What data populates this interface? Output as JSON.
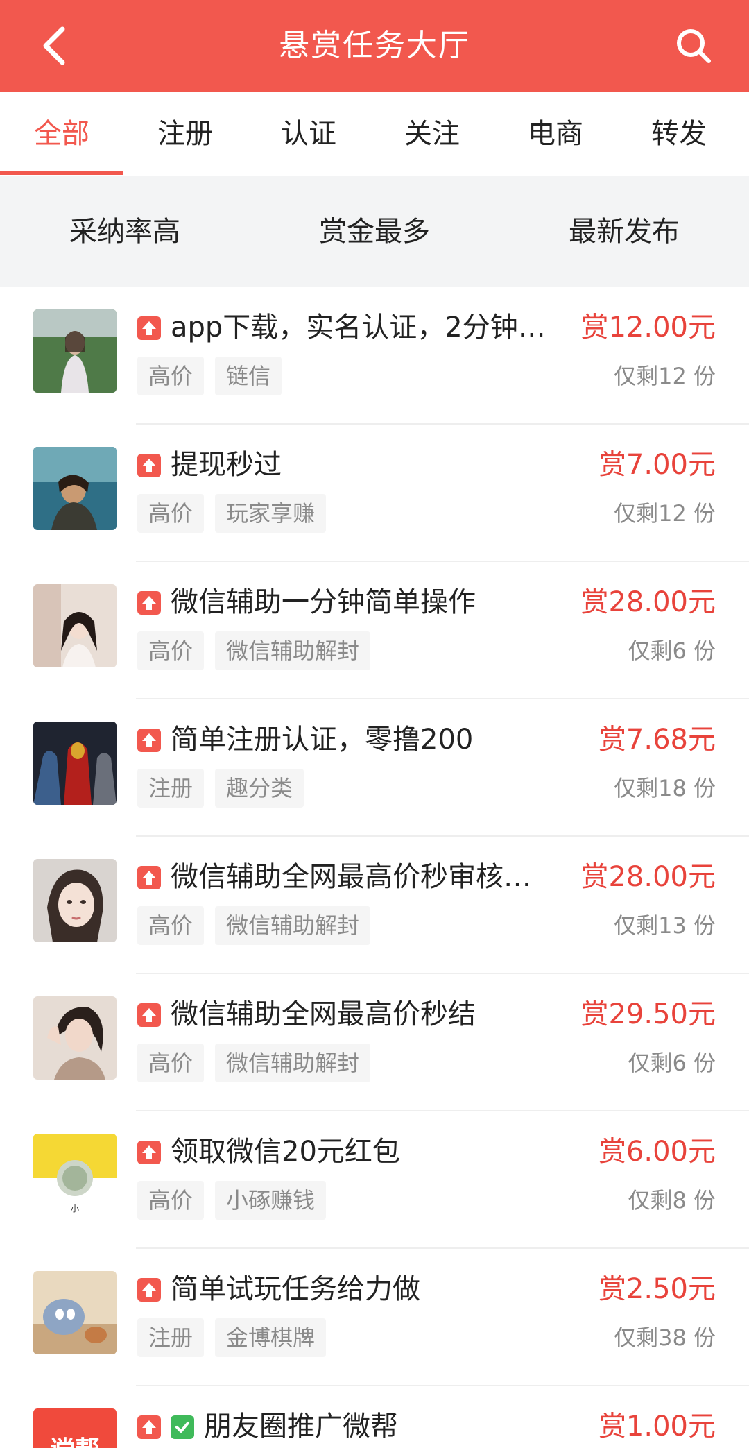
{
  "header": {
    "title": "悬赏任务大厅",
    "back_icon": "chevron-left-icon",
    "search_icon": "search-icon"
  },
  "colors": {
    "brand": "#f2584e",
    "reward": "#e8433b",
    "verify": "#3fba5a"
  },
  "tabs": [
    {
      "label": "全部",
      "active": true
    },
    {
      "label": "注册",
      "active": false
    },
    {
      "label": "认证",
      "active": false
    },
    {
      "label": "关注",
      "active": false
    },
    {
      "label": "电商",
      "active": false
    },
    {
      "label": "转发",
      "active": false
    }
  ],
  "sort_options": [
    {
      "label": "采纳率高"
    },
    {
      "label": "赏金最多"
    },
    {
      "label": "最新发布"
    }
  ],
  "tasks": [
    {
      "title": "app下载，实名认证，2分钟…",
      "tags": [
        "高价",
        "链信"
      ],
      "reward": "赏12.00元",
      "remaining": "仅剩12 份",
      "verified": false
    },
    {
      "title": "提现秒过",
      "tags": [
        "高价",
        "玩家享赚"
      ],
      "reward": "赏7.00元",
      "remaining": "仅剩12 份",
      "verified": false
    },
    {
      "title": "微信辅助一分钟简单操作",
      "tags": [
        "高价",
        "微信辅助解封"
      ],
      "reward": "赏28.00元",
      "remaining": "仅剩6 份",
      "verified": false
    },
    {
      "title": "简单注册认证，零撸200",
      "tags": [
        "注册",
        "趣分类"
      ],
      "reward": "赏7.68元",
      "remaining": "仅剩18 份",
      "verified": false
    },
    {
      "title": "微信辅助全网最高价秒审核…",
      "tags": [
        "高价",
        "微信辅助解封"
      ],
      "reward": "赏28.00元",
      "remaining": "仅剩13 份",
      "verified": false
    },
    {
      "title": "微信辅助全网最高价秒结",
      "tags": [
        "高价",
        "微信辅助解封"
      ],
      "reward": "赏29.50元",
      "remaining": "仅剩6 份",
      "verified": false
    },
    {
      "title": "领取微信20元红包",
      "tags": [
        "高价",
        "小硺赚钱"
      ],
      "reward": "赏6.00元",
      "remaining": "仅剩8 份",
      "verified": false,
      "thumb_text": "小"
    },
    {
      "title": "简单试玩任务给力做",
      "tags": [
        "注册",
        "金博棋牌"
      ],
      "reward": "赏2.50元",
      "remaining": "仅剩38 份",
      "verified": false
    },
    {
      "title": "朋友圈推广微帮",
      "tags": [],
      "reward": "赏1.00元",
      "remaining": "",
      "verified": true,
      "thumb_text": "谠帮"
    }
  ]
}
